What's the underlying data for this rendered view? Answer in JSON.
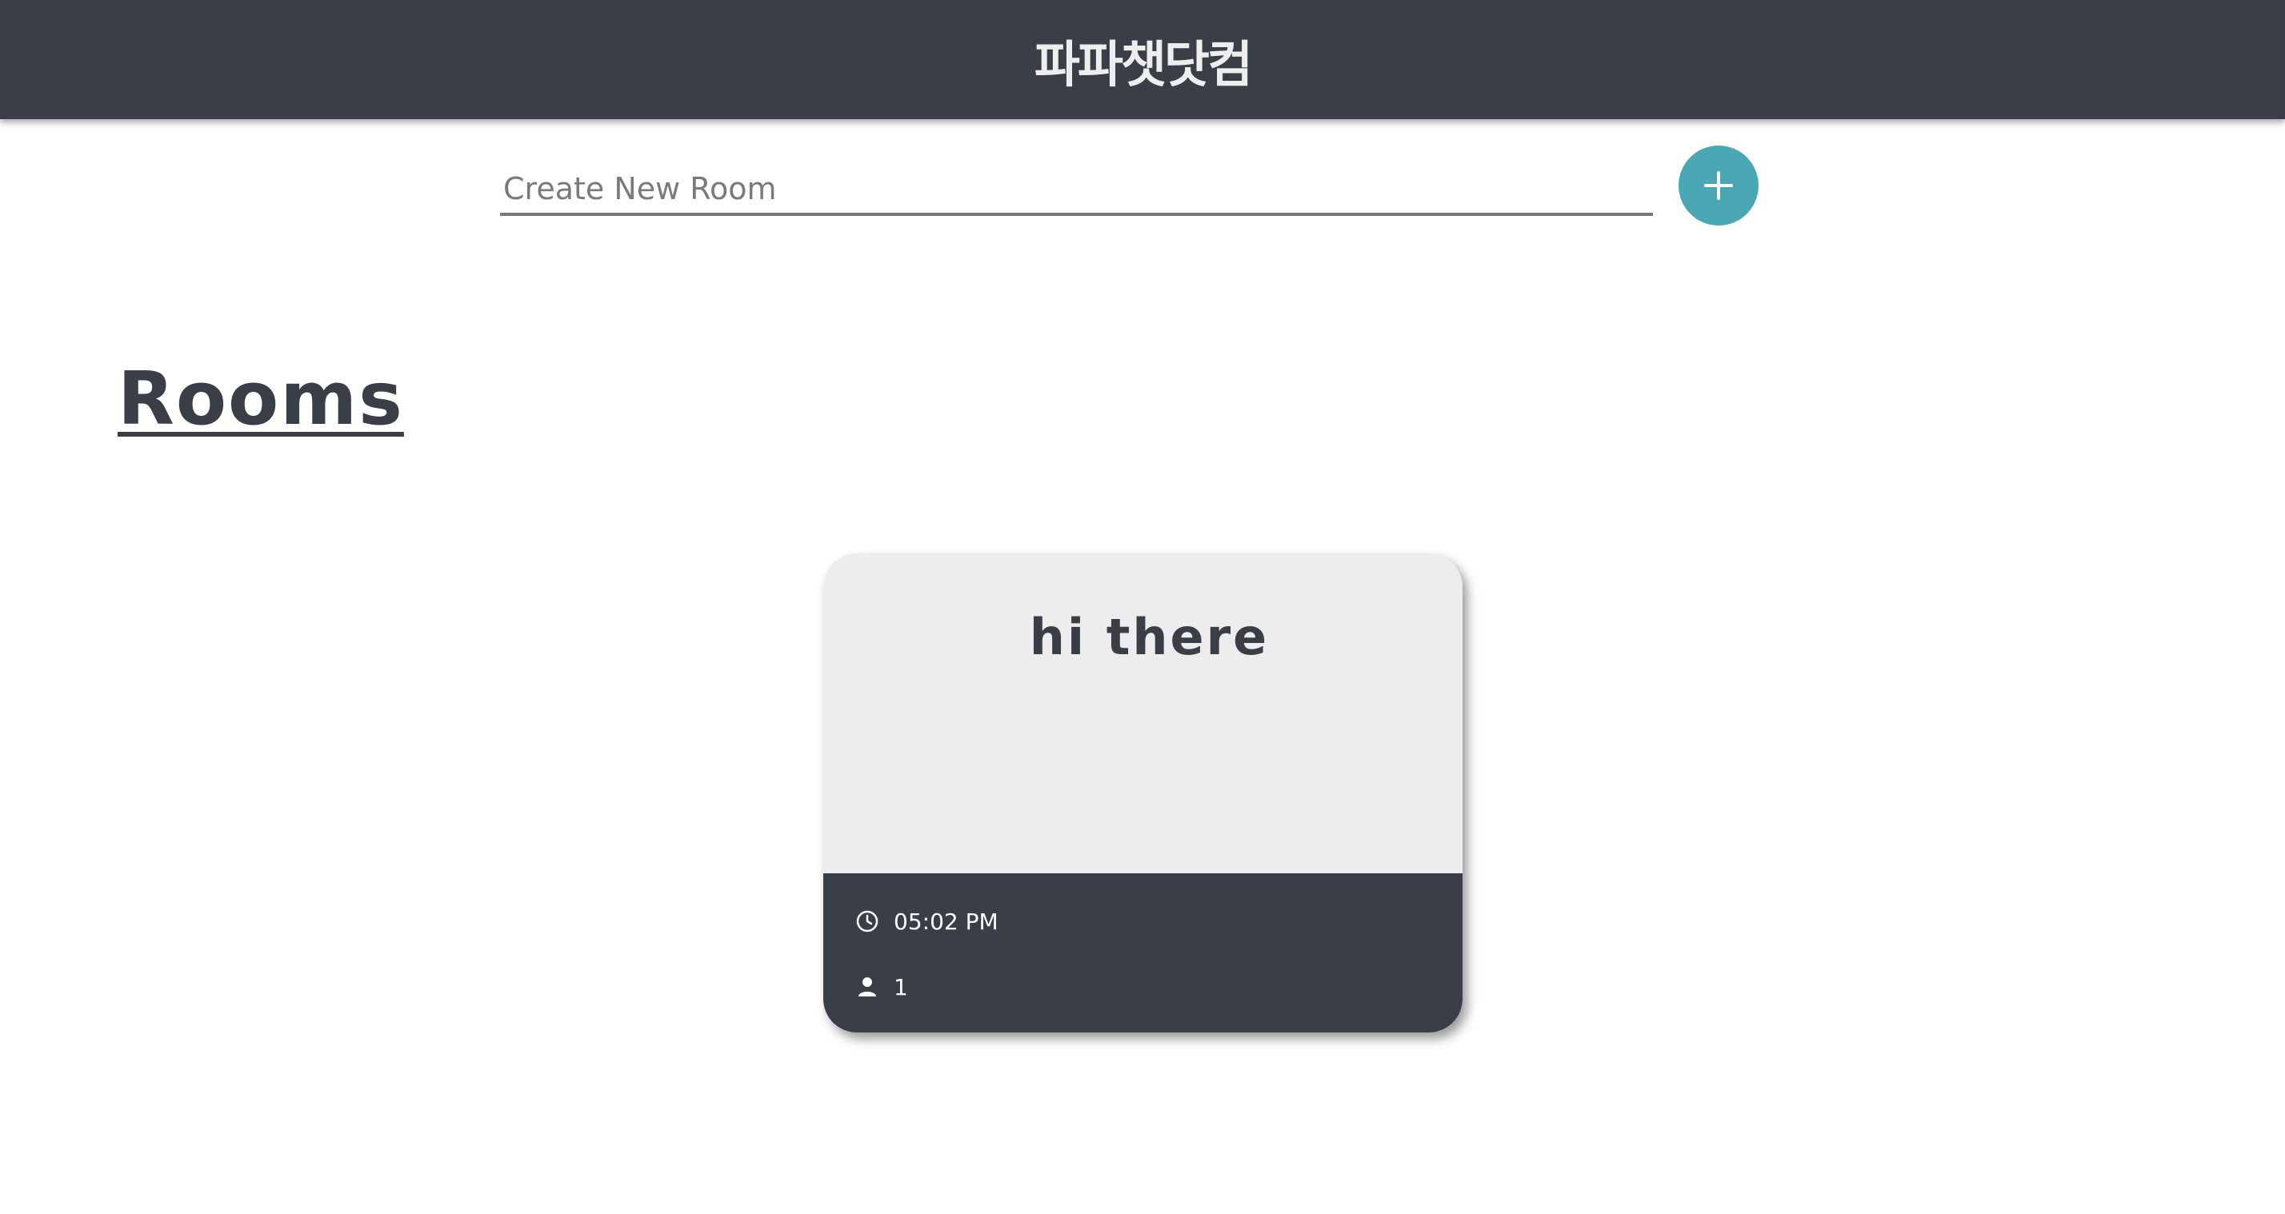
{
  "header": {
    "brand": "파파챗닷컴"
  },
  "create_room": {
    "placeholder": "Create New Room",
    "add_icon": "plus-icon"
  },
  "rooms_section": {
    "heading": "Rooms"
  },
  "rooms": [
    {
      "title": "hi there",
      "time": "05:02 PM",
      "participants": "1",
      "time_icon": "clock-icon",
      "participants_icon": "person-icon"
    }
  ],
  "colors": {
    "header_bg": "#3a3e46",
    "accent": "#4aa8b5",
    "card_top_bg": "#ededed",
    "card_bottom_bg": "#3a3e46",
    "input_underline": "#7a7a7a"
  }
}
